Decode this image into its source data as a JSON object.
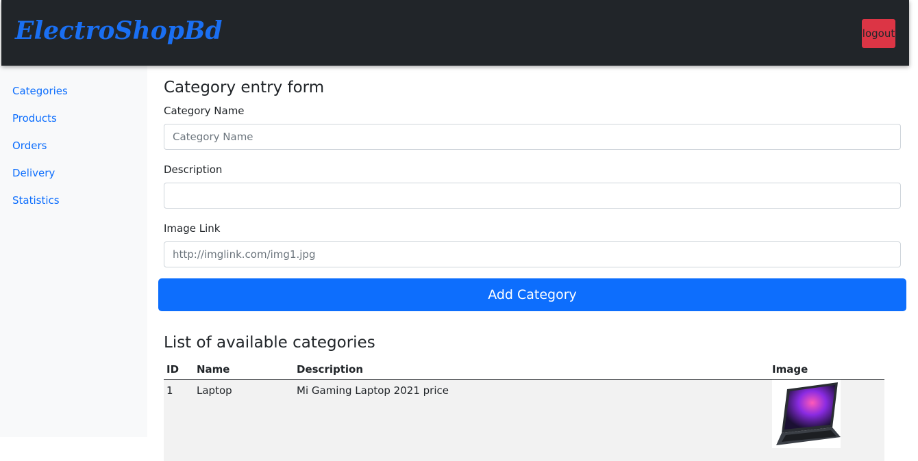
{
  "navbar": {
    "brand": "ElectroShopBd",
    "logout_label": "logout"
  },
  "sidebar": {
    "items": [
      {
        "label": "Categories"
      },
      {
        "label": "Products"
      },
      {
        "label": "Orders"
      },
      {
        "label": "Delivery"
      },
      {
        "label": "Statistics"
      }
    ]
  },
  "form": {
    "title": "Category entry form",
    "name_label": "Category Name",
    "name_placeholder": "Category Name",
    "name_value": "",
    "description_label": "Description",
    "description_placeholder": "",
    "description_value": "",
    "image_label": "Image Link",
    "image_placeholder": "http://imglink.com/img1.jpg",
    "image_value": "",
    "submit_label": "Add Category"
  },
  "list": {
    "title": "List of available categories",
    "columns": [
      "ID",
      "Name",
      "Description",
      "Image"
    ],
    "rows": [
      {
        "id": "1",
        "name": "Laptop",
        "description": "Mi Gaming Laptop 2021 price",
        "image_icon": "laptop-thumbnail"
      }
    ]
  },
  "colors": {
    "navbar_bg": "#212529",
    "brand": "#1a6ff2",
    "logout_bg": "#dc3545",
    "link": "#0d6efd",
    "primary_button": "#0d6efd",
    "sidebar_bg": "#f8f9fa",
    "row_bg": "#f2f2f2"
  }
}
